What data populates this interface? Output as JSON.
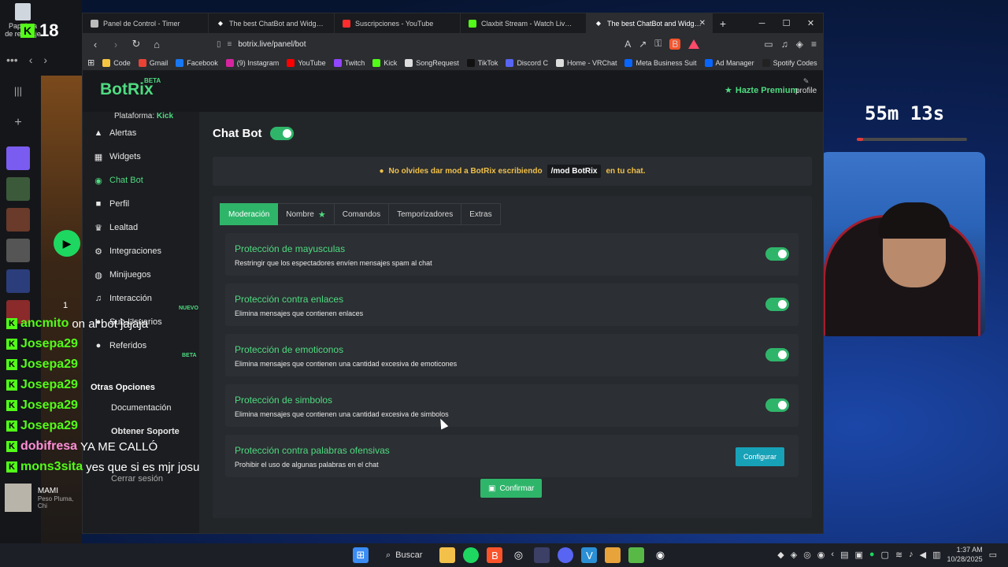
{
  "desktop": {
    "recycle_label": "Papelera de reciclaje",
    "kick_count": "18",
    "spotify": {
      "track_title": "MAMI",
      "track_artist": "Peso Pluma, Chi",
      "list_number": "1"
    }
  },
  "stream": {
    "timer": "55m 13s",
    "timer_progress": 0.06,
    "chat": [
      {
        "user": "ancmito",
        "msg": "on al bot jajaja",
        "pink": false
      },
      {
        "user": "Josepa29",
        "msg": "",
        "pink": false
      },
      {
        "user": "Josepa29",
        "msg": "",
        "pink": false
      },
      {
        "user": "Josepa29",
        "msg": "",
        "pink": false
      },
      {
        "user": "Josepa29",
        "msg": "",
        "pink": false
      },
      {
        "user": "Josepa29",
        "msg": "",
        "pink": false
      },
      {
        "user": "dobifresa",
        "msg": "YA ME CALLÓ",
        "pink": true
      },
      {
        "user": "mons3sita",
        "msg": "yes que si es mjr josu",
        "pink": false
      }
    ]
  },
  "browser": {
    "tabs": [
      {
        "label": "Panel de Control - Timer",
        "color": "#cfcfcf",
        "icon": "globe-icon"
      },
      {
        "label": "The best ChatBot and Widgets f",
        "color": "#ffffff",
        "icon": "botrix-icon"
      },
      {
        "label": "Suscripciones - YouTube",
        "color": "#ff2d2d",
        "icon": "youtube-icon"
      },
      {
        "label": "Claxbit Stream - Watch Live on Kick",
        "color": "#53fc18",
        "icon": "kick-icon"
      },
      {
        "label": "The best ChatBot and Widgets",
        "color": "#ffffff",
        "icon": "botrix-icon"
      }
    ],
    "url": "botrix.live/panel/bot",
    "bookmarks": [
      {
        "label": "Code",
        "color": "#f5c542"
      },
      {
        "label": "Gmail",
        "color": "#ea4335"
      },
      {
        "label": "Facebook",
        "color": "#1877f2"
      },
      {
        "label": "(9) Instagram",
        "color": "#d6249f"
      },
      {
        "label": "YouTube",
        "color": "#ff0000"
      },
      {
        "label": "Twitch",
        "color": "#9146ff"
      },
      {
        "label": "Kick",
        "color": "#53fc18"
      },
      {
        "label": "SongRequest",
        "color": "#dddddd"
      },
      {
        "label": "TikTok",
        "color": "#111111"
      },
      {
        "label": "Discord C",
        "color": "#5865f2"
      },
      {
        "label": "Home - VRChat",
        "color": "#dddddd"
      },
      {
        "label": "Meta Business Suit",
        "color": "#0866ff"
      },
      {
        "label": "Ad Manager",
        "color": "#0866ff"
      },
      {
        "label": "Spotify Codes",
        "color": "#222222"
      }
    ]
  },
  "app": {
    "logo": "BotRix",
    "logo_beta": "BETA",
    "premium_label": "Hazte Premium",
    "profile_label": "profile",
    "platform_label": "Plataforma:",
    "platform_value": "Kick",
    "sidebar": [
      {
        "label": "Alertas",
        "icon": "bell-icon",
        "glyph": "▲"
      },
      {
        "label": "Widgets",
        "icon": "grid-icon",
        "glyph": "▦"
      },
      {
        "label": "Chat Bot",
        "icon": "robot-icon",
        "glyph": "◉"
      },
      {
        "label": "Perfil",
        "icon": "user-icon",
        "glyph": "■"
      },
      {
        "label": "Lealtad",
        "icon": "trophy-icon",
        "glyph": "♛"
      },
      {
        "label": "Integraciones",
        "icon": "plug-icon",
        "glyph": "⚙"
      },
      {
        "label": "Minijuegos",
        "icon": "gamepad-icon",
        "glyph": "◍"
      },
      {
        "label": "Interacción",
        "icon": "music-icon",
        "glyph": "♫"
      },
      {
        "label": "Sub-Usuarios",
        "icon": "users-icon",
        "glyph": "●"
      },
      {
        "label": "Referidos",
        "icon": "people-icon",
        "glyph": "●"
      }
    ],
    "badge_new": "NUEVO",
    "badge_beta": "BETA",
    "other_options_label": "Otras Opciones",
    "docs_label": "Documentación",
    "support_label": "Obtener Soporte",
    "logout_label": "Cerrar sesión",
    "chatbot_title": "Chat Bot",
    "chatbot_enabled": true,
    "notice_prefix": "No olvides dar mod a BotRix escribiendo",
    "notice_code": "/mod BotRix",
    "notice_suffix": "en tu chat.",
    "tabs": [
      {
        "label": "Moderación",
        "active": true,
        "star": false
      },
      {
        "label": "Nombre",
        "active": false,
        "star": true
      },
      {
        "label": "Comandos",
        "active": false,
        "star": false
      },
      {
        "label": "Temporizadores",
        "active": false,
        "star": false
      },
      {
        "label": "Extras",
        "active": false,
        "star": false
      }
    ],
    "rows": [
      {
        "title": "Protección de mayusculas",
        "desc": "Restringir que los espectadores envíen mensajes spam al chat",
        "toggle": true
      },
      {
        "title": "Protección contra enlaces",
        "desc": "Elimina mensajes que contienen enlaces",
        "toggle": true
      },
      {
        "title": "Protección de emoticonos",
        "desc": "Elimina mensajes que contienen una cantidad excesiva de emoticones",
        "toggle": true
      },
      {
        "title": "Protección de simbolos",
        "desc": "Elimina mensajes que contienen una cantidad excesiva de simbolos",
        "toggle": true
      },
      {
        "title": "Protección contra palabras ofensivas",
        "desc": "Prohibir el uso de algunas palabras en el chat",
        "toggle": false
      }
    ],
    "configure_label": "Configurar",
    "confirm_label": "Confirmar"
  },
  "taskbar": {
    "search_label": "Buscar",
    "time": "1:37 AM",
    "date": "10/28/2025"
  }
}
